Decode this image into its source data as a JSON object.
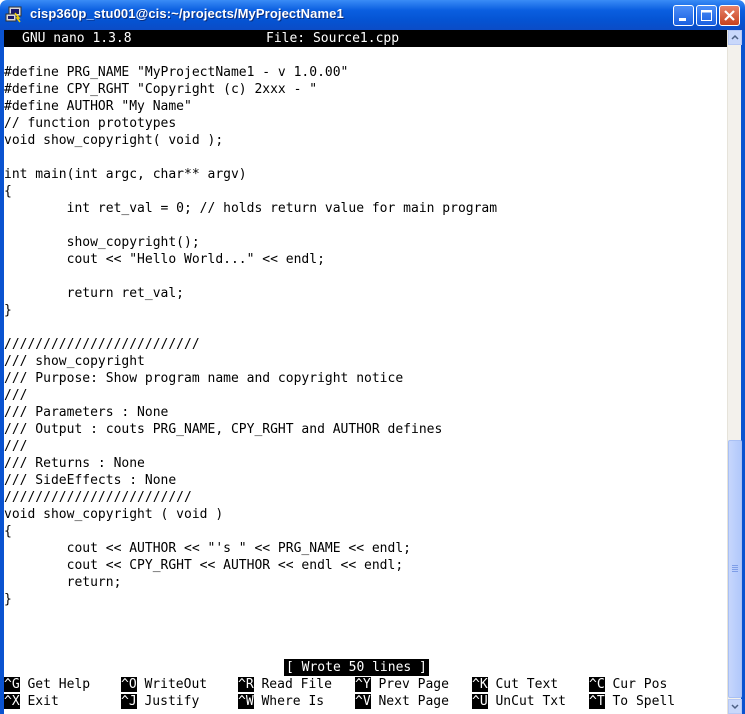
{
  "window": {
    "title": "cisp360p_stu001@cis:~/projects/MyProjectName1",
    "icon": "putty-terminal-icon"
  },
  "nano": {
    "version": "GNU nano 1.3.8",
    "file_label": "File: Source1.cpp",
    "status": "[ Wrote 50 lines ]"
  },
  "code_lines": [
    "#define PRG_NAME \"MyProjectName1 - v 1.0.00\"",
    "#define CPY_RGHT \"Copyright (c) 2xxx - \"",
    "#define AUTHOR \"My Name\"",
    "// function prototypes",
    "void show_copyright( void );",
    "",
    "int main(int argc, char** argv)",
    "{",
    "        int ret_val = 0; // holds return value for main program",
    "",
    "        show_copyright();",
    "        cout << \"Hello World...\" << endl;",
    "",
    "        return ret_val;",
    "}",
    "",
    "/////////////////////////",
    "/// show_copyright",
    "/// Purpose: Show program name and copyright notice",
    "///",
    "/// Parameters : None",
    "/// Output : couts PRG_NAME, CPY_RGHT and AUTHOR defines",
    "///",
    "/// Returns : None",
    "/// SideEffects : None",
    "////////////////////////",
    "void show_copyright ( void )",
    "{",
    "        cout << AUTHOR << \"'s \" << PRG_NAME << endl;",
    "        cout << CPY_RGHT << AUTHOR << endl << endl;",
    "        return;",
    "}"
  ],
  "shortcuts": {
    "row1": [
      {
        "key": "^G",
        "label": "Get Help"
      },
      {
        "key": "^O",
        "label": "WriteOut"
      },
      {
        "key": "^R",
        "label": "Read File"
      },
      {
        "key": "^Y",
        "label": "Prev Page"
      },
      {
        "key": "^K",
        "label": "Cut Text"
      },
      {
        "key": "^C",
        "label": "Cur Pos"
      }
    ],
    "row2": [
      {
        "key": "^X",
        "label": "Exit"
      },
      {
        "key": "^J",
        "label": "Justify"
      },
      {
        "key": "^W",
        "label": "Where Is"
      },
      {
        "key": "^V",
        "label": "Next Page"
      },
      {
        "key": "^U",
        "label": "UnCut Txt"
      },
      {
        "key": "^T",
        "label": "To Spell"
      }
    ]
  },
  "colors": {
    "titlebar": "#0553d2",
    "terminal_bg": "#ffffff",
    "terminal_fg": "#000000",
    "inverse_bg": "#000000",
    "inverse_fg": "#ffffff"
  }
}
